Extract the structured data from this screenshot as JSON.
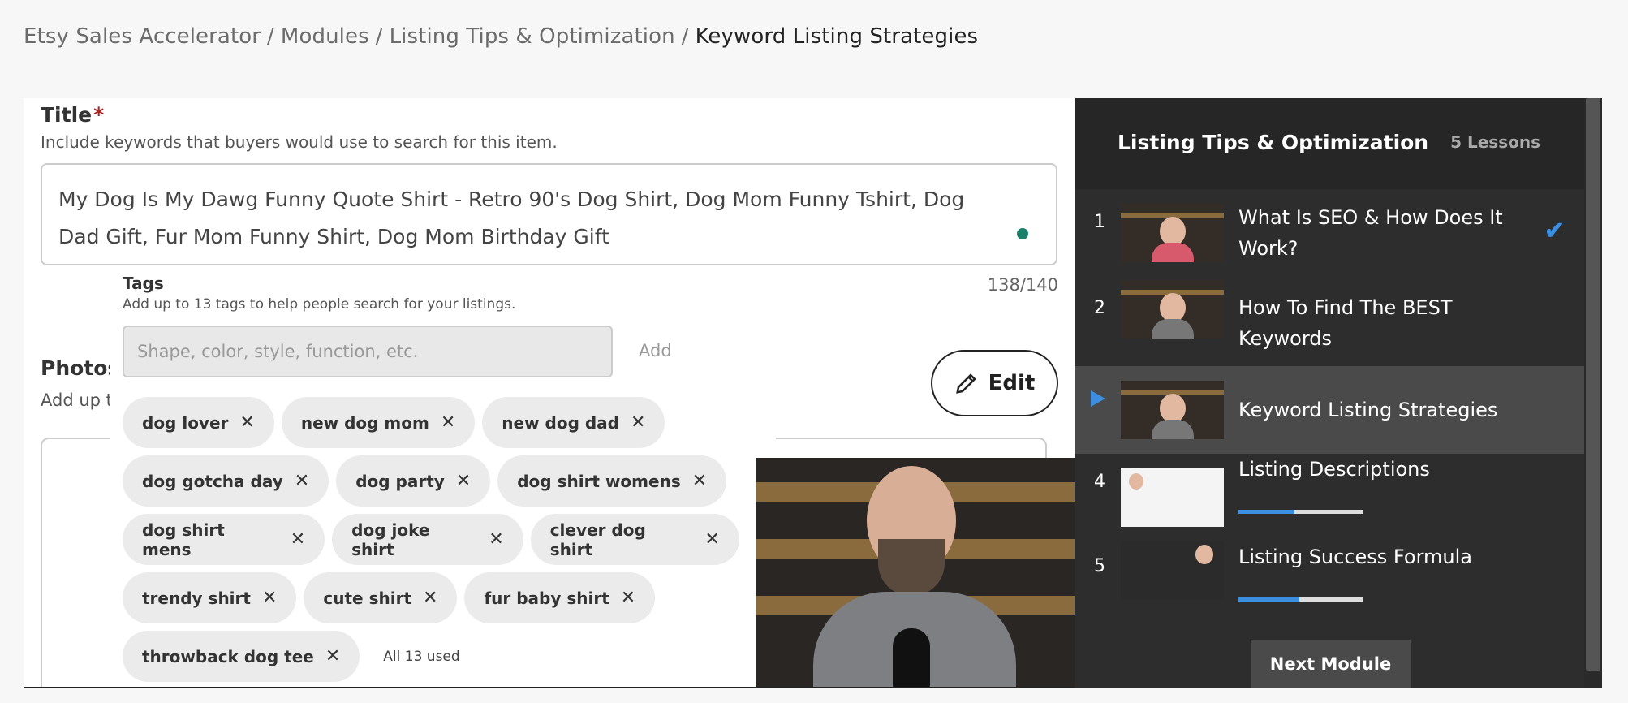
{
  "breadcrumb": {
    "items": [
      "Etsy Sales Accelerator",
      "Modules",
      "Listing Tips & Optimization"
    ],
    "current": "Keyword Listing Strategies",
    "separator": "/"
  },
  "video": {
    "title_label": "Title",
    "required_mark": "*",
    "title_help": "Include keywords that buyers would use to search for this item.",
    "title_value": "My Dog Is My Dawg Funny Quote Shirt - Retro 90's Dog Shirt, Dog Mom Funny Tshirt, Dog Dad Gift, Fur Mom Funny Shirt, Dog Mom Birthday Gift",
    "char_count": "138/140",
    "photos_label": "Photos",
    "photos_help": "Add up t",
    "tags_label": "Tags",
    "tags_help": "Add up to 13 tags to help people search for your listings.",
    "tags_placeholder": "Shape, color, style, function, etc.",
    "tags_add": "Add",
    "tags": [
      [
        "dog lover",
        "new dog mom",
        "new dog dad"
      ],
      [
        "dog gotcha day",
        "dog party",
        "dog shirt womens"
      ],
      [
        "dog shirt mens",
        "dog joke shirt",
        "clever dog shirt"
      ],
      [
        "trendy shirt",
        "cute shirt",
        "fur baby shirt"
      ],
      [
        "throwback dog tee"
      ]
    ],
    "tags_used": "All 13 used",
    "edit_label": "Edit"
  },
  "sidebar": {
    "title": "Listing Tips & Optimization",
    "count": "5 Lessons",
    "accent": "#3b8ee0",
    "lessons": [
      {
        "num": "1",
        "label": "What Is SEO & How Does It Work?",
        "completed": true
      },
      {
        "num": "2",
        "label": "How To Find The BEST Keywords",
        "completed": false
      },
      {
        "num": "",
        "label": "Keyword Listing Strategies",
        "active": true
      },
      {
        "num": "4",
        "label": "Listing Descriptions",
        "progress": 0.45
      },
      {
        "num": "5",
        "label": "Listing Success Formula",
        "progress": 0.49
      }
    ],
    "next_label": "Next Module"
  }
}
